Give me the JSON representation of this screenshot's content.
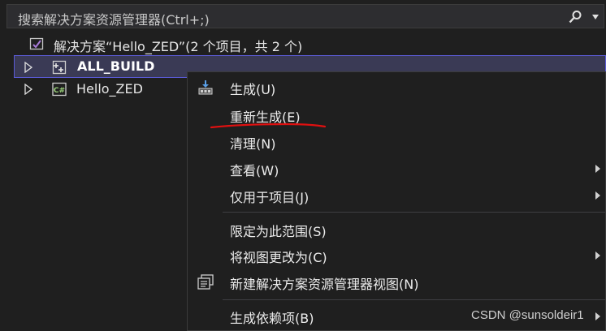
{
  "search": {
    "placeholder": "搜索解决方案资源管理器(Ctrl+;)"
  },
  "tree": {
    "solution_label": "解决方案“Hello_ZED”(2 个项目，共 2 个)",
    "projects": [
      {
        "label": "ALL_BUILD",
        "selected": true,
        "icon": "cmake-project-icon"
      },
      {
        "label": "Hello_ZED",
        "selected": false,
        "icon": "csharp-project-icon"
      }
    ]
  },
  "context_menu": {
    "items": [
      {
        "label": "生成(U)",
        "icon": "build-icon"
      },
      {
        "label": "重新生成(E)"
      },
      {
        "label": "清理(N)"
      },
      {
        "label": "查看(W)",
        "has_submenu": true
      },
      {
        "label": "仅用于项目(J)",
        "has_submenu": true
      },
      {
        "label": "限定为此范围(S)"
      },
      {
        "label": "将视图更改为(C)",
        "has_submenu": true
      },
      {
        "label": "新建解决方案资源管理器视图(N)",
        "icon": "new-explorer-view-icon"
      },
      {
        "label": "生成依赖项(B)",
        "has_submenu": true
      }
    ]
  },
  "colors": {
    "accent": "#5b5bd6",
    "underline": "#e01010",
    "background": "#1f1f1f"
  },
  "watermark": "CSDN @sunsoldeir1"
}
